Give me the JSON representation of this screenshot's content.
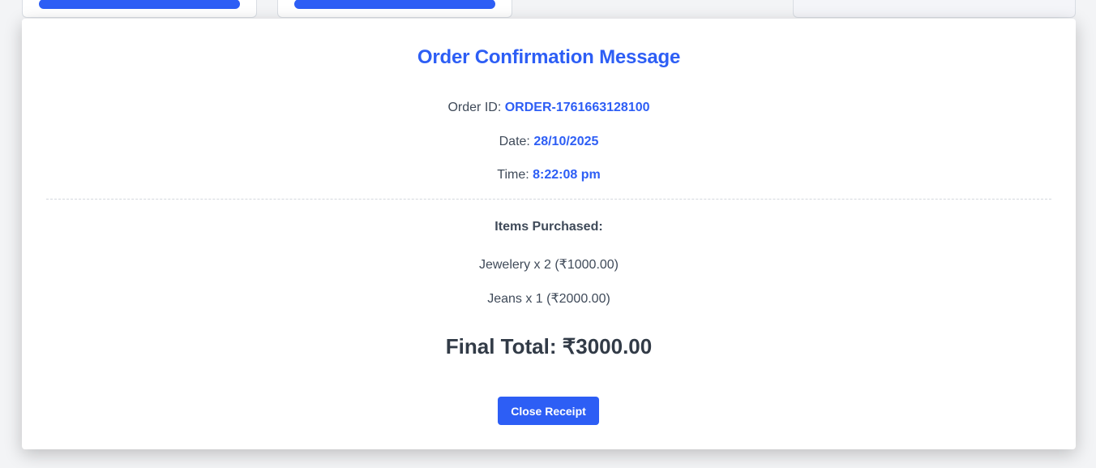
{
  "receipt": {
    "title": "Order Confirmation Message",
    "order_id_label": "Order ID:",
    "order_id": "ORDER-1761663128100",
    "date_label": "Date:",
    "date": "28/10/2025",
    "time_label": "Time:",
    "time": "8:22:08 pm",
    "items_heading": "Items Purchased:",
    "items": [
      "Jewelery x 2 (₹1000.00)",
      "Jeans x 1 (₹2000.00)"
    ],
    "final_total": "Final Total: ₹3000.00",
    "close_label": "Close Receipt"
  },
  "colors": {
    "accent": "#2d5ef5",
    "text": "#3f4a59"
  }
}
